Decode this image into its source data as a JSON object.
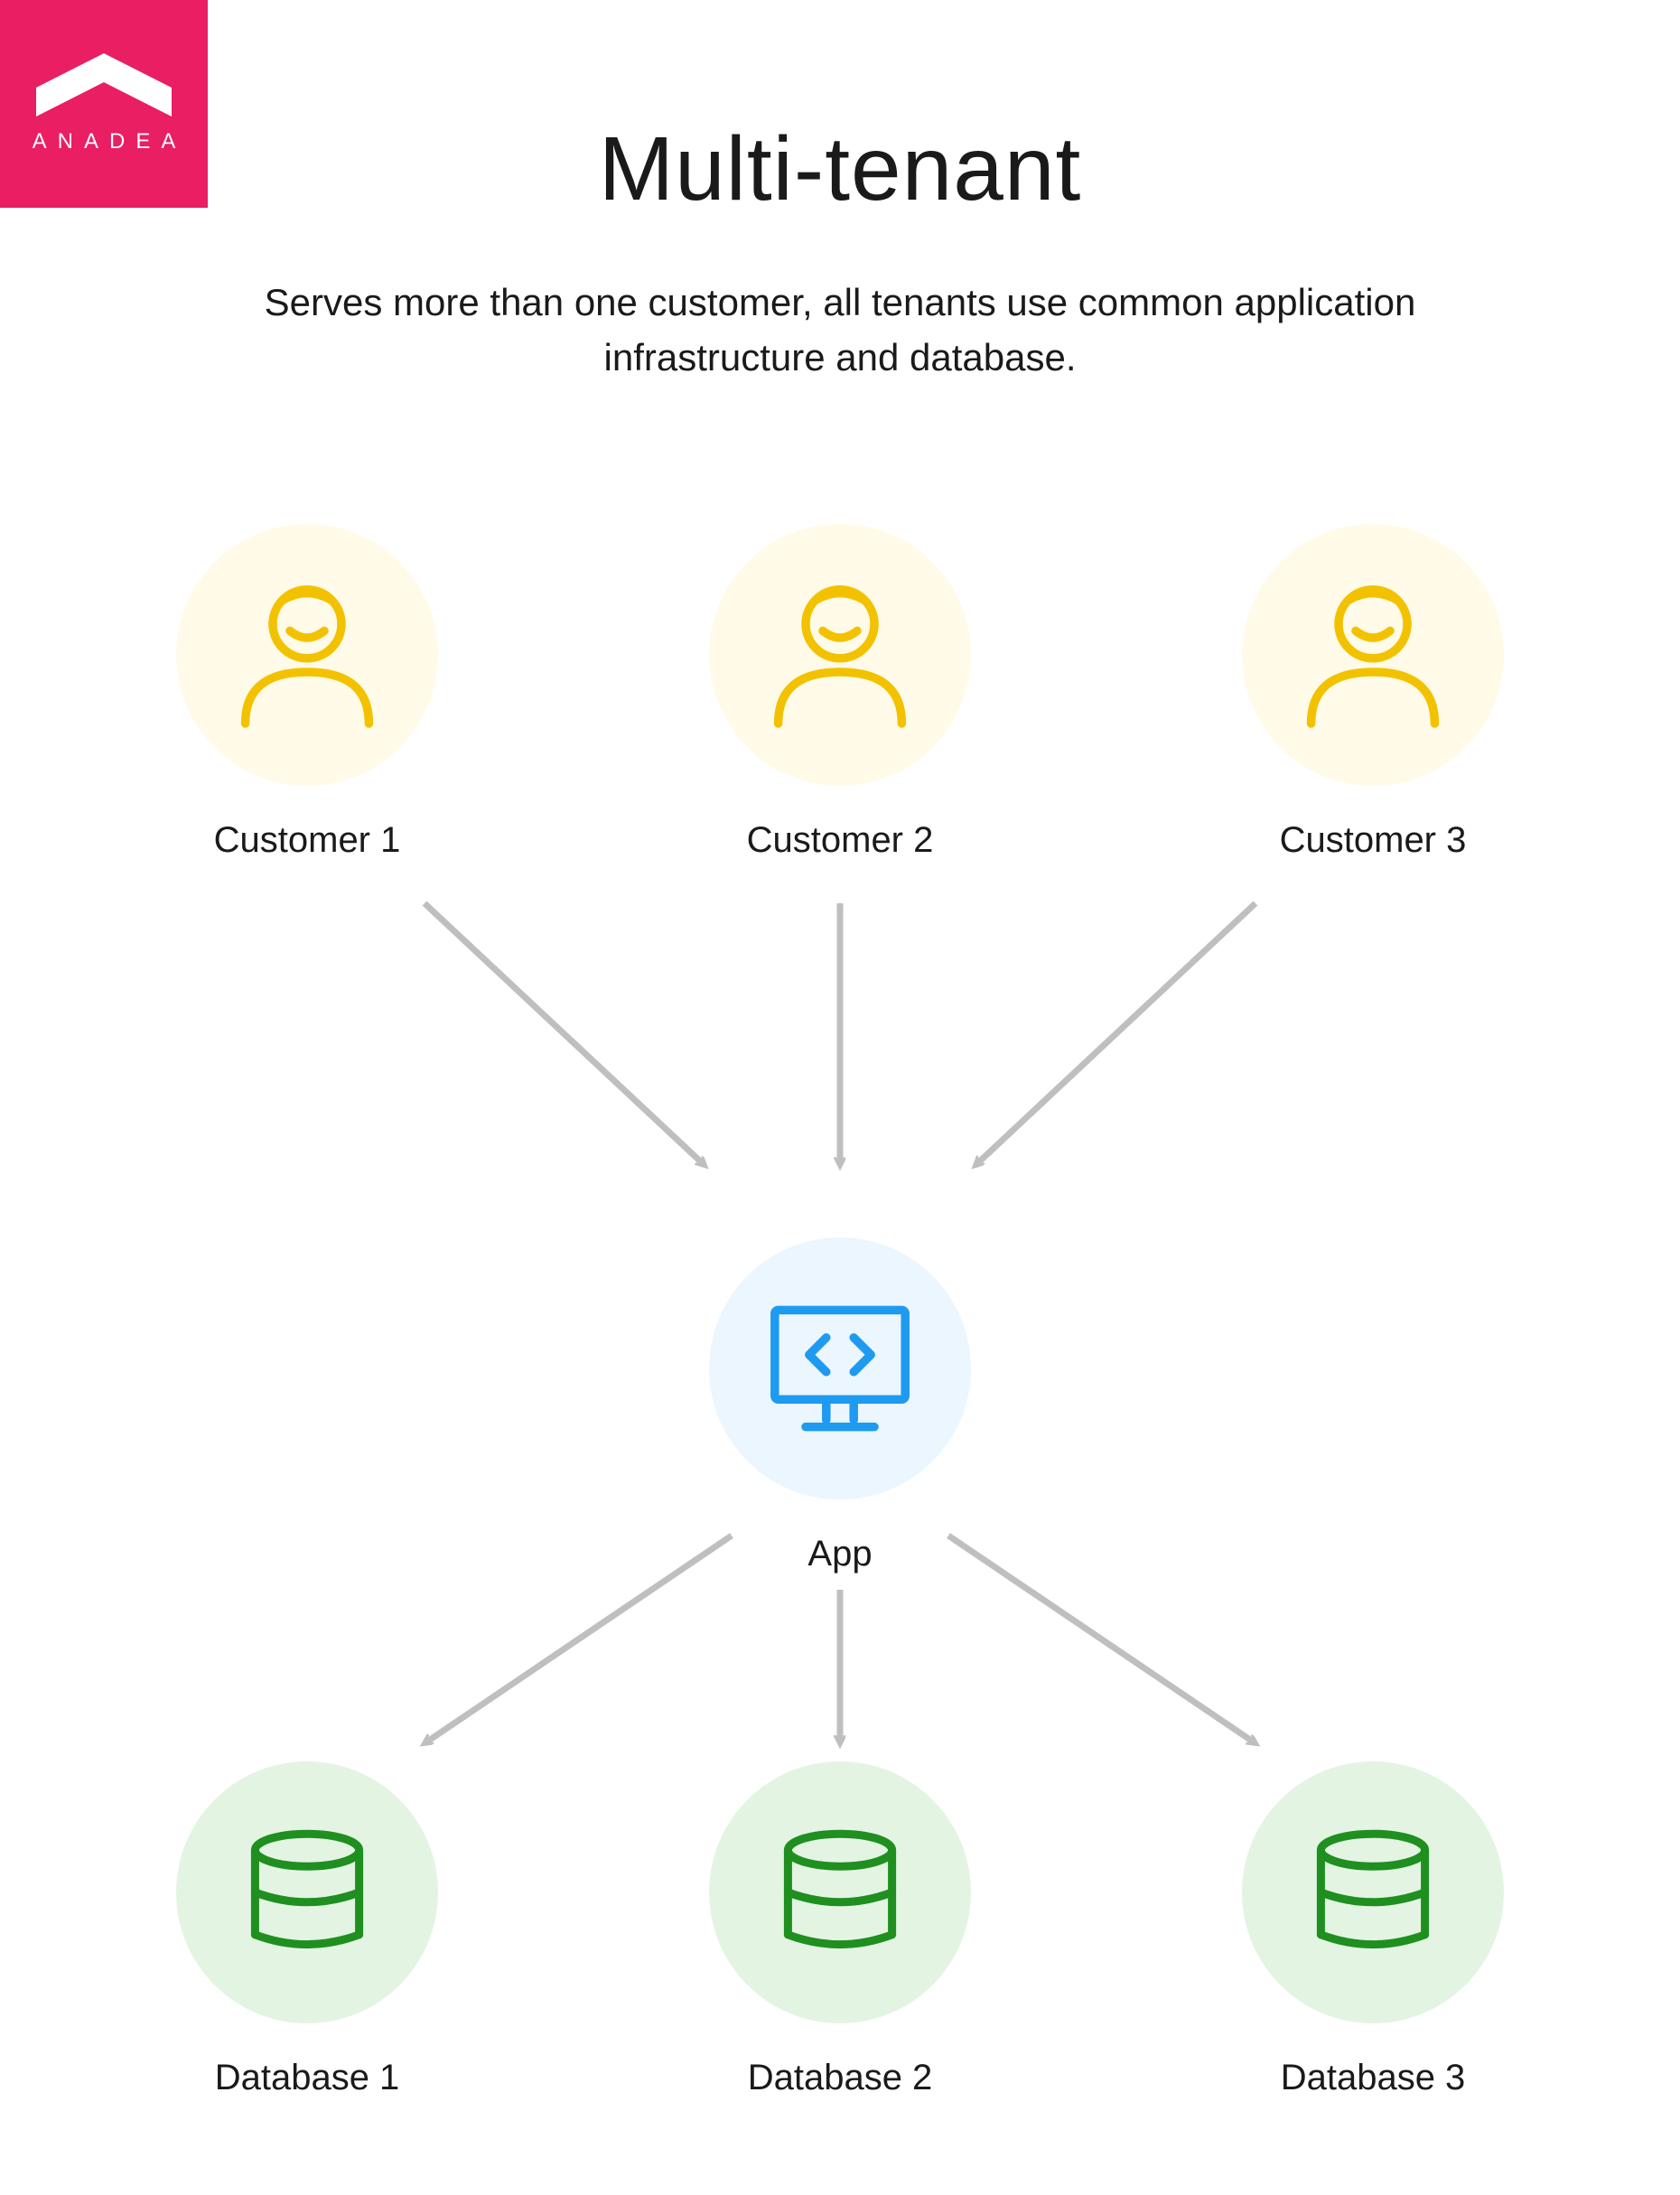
{
  "brand": {
    "name": "ANADEA",
    "color": "#e91e63"
  },
  "title": "Multi-tenant",
  "subtitle": "Serves more than one customer, all tenants use common application infrastructure and database.",
  "customers": [
    {
      "label": "Customer 1",
      "icon": "user-icon"
    },
    {
      "label": "Customer 2",
      "icon": "user-icon"
    },
    {
      "label": "Customer 3",
      "icon": "user-icon"
    }
  ],
  "app": {
    "label": "App",
    "icon": "code-monitor-icon"
  },
  "databases": [
    {
      "label": "Database 1",
      "icon": "database-icon"
    },
    {
      "label": "Database 2",
      "icon": "database-icon"
    },
    {
      "label": "Database 3",
      "icon": "database-icon"
    }
  ],
  "colors": {
    "customer_stroke": "#f2c200",
    "customer_bg": "#fffbe8",
    "app_stroke": "#1e9bf0",
    "app_bg": "#ebf6ff",
    "db_stroke": "#1f8f1f",
    "db_bg": "#e3f4e3",
    "arrow": "#bfbfbf"
  },
  "diagram": {
    "edges": [
      {
        "from": "customer-1",
        "to": "app"
      },
      {
        "from": "customer-2",
        "to": "app"
      },
      {
        "from": "customer-3",
        "to": "app"
      },
      {
        "from": "app",
        "to": "database-1"
      },
      {
        "from": "app",
        "to": "database-2"
      },
      {
        "from": "app",
        "to": "database-3"
      }
    ]
  }
}
